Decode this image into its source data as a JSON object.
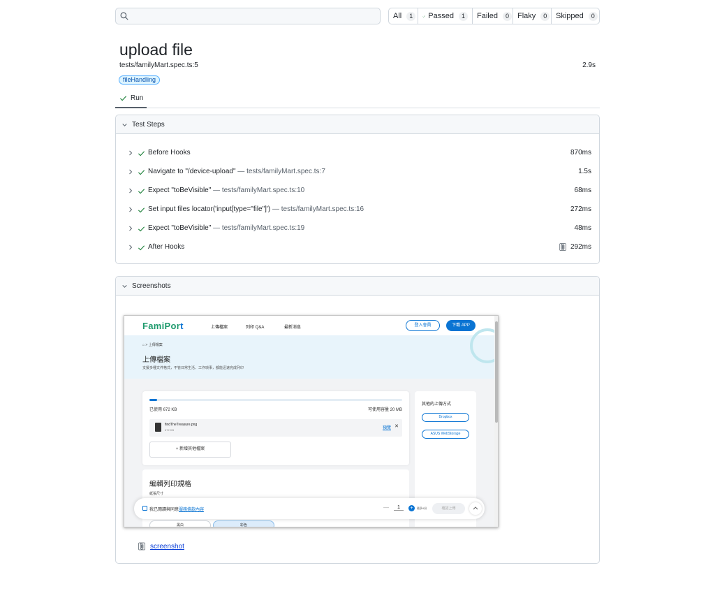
{
  "search": {
    "placeholder": "",
    "icon": "search-icon"
  },
  "filters": [
    {
      "label": "All",
      "count": "1"
    },
    {
      "label": "Passed",
      "count": "1",
      "icon": "check-icon"
    },
    {
      "label": "Failed",
      "count": "0"
    },
    {
      "label": "Flaky",
      "count": "0"
    },
    {
      "label": "Skipped",
      "count": "0"
    }
  ],
  "test": {
    "title": "upload file",
    "location": "tests/familyMart.spec.ts:5",
    "duration": "2.9s",
    "tag": "fileHandling"
  },
  "tabs": [
    {
      "label": "Run",
      "icon": "check-icon"
    }
  ],
  "steps_panel": {
    "title": "Test Steps",
    "steps": [
      {
        "label": "Before Hooks",
        "location": "",
        "time": "870ms"
      },
      {
        "label": "Navigate to \"/device-upload\"",
        "location": "— tests/familyMart.spec.ts:7",
        "time": "1.5s"
      },
      {
        "label": "Expect \"toBeVisible\"",
        "location": "— tests/familyMart.spec.ts:10",
        "time": "68ms"
      },
      {
        "label": "Set input files locator('input[type=\"file\"]')",
        "location": "— tests/familyMart.spec.ts:16",
        "time": "272ms"
      },
      {
        "label": "Expect \"toBeVisible\"",
        "location": "— tests/familyMart.spec.ts:19",
        "time": "48ms"
      },
      {
        "label": "After Hooks",
        "location": "",
        "time": "292ms",
        "icon": "attachment-icon"
      }
    ]
  },
  "screenshots_panel": {
    "title": "Screenshots",
    "attachment_label": "screenshot"
  },
  "famiport": {
    "logo_a": "FamiPor",
    "logo_b": "t",
    "nav": [
      "上傳檔案",
      "列印 Q&A",
      "最新消息"
    ],
    "login": "登入會員",
    "download_app": "下載 APP",
    "breadcrumb": "⌂ > 上傳檔案",
    "heading": "上傳檔案",
    "subheading": "支援多種文件格式，不管日常生活、工作瑣事，都能迅速完成列印",
    "used": "已使用 672 KB",
    "available": "可使用容量 20 MB",
    "progress": 0.03,
    "file_name": "findTheTreasure.png",
    "file_size": "672 KB",
    "preview": "預覽",
    "add_file": "+ 新增其他檔案",
    "other_methods": "其他的上傳方式",
    "dropbox": "Dropbox",
    "asus": "ASUS WebStorage",
    "edit_title": "編輯列印規格",
    "paper_size": "紙張尺寸",
    "agree_text": "我已閱讀與同意",
    "agree_link": "服務條款內容",
    "quantity": "1",
    "max_copies": "最多9份",
    "confirm": "確認上傳",
    "btn_left": "黑白",
    "btn_right": "彩色"
  },
  "colors": {
    "pass": "#1a7f37",
    "link": "#0a3fd8",
    "famiport_blue": "#0a74d3"
  }
}
